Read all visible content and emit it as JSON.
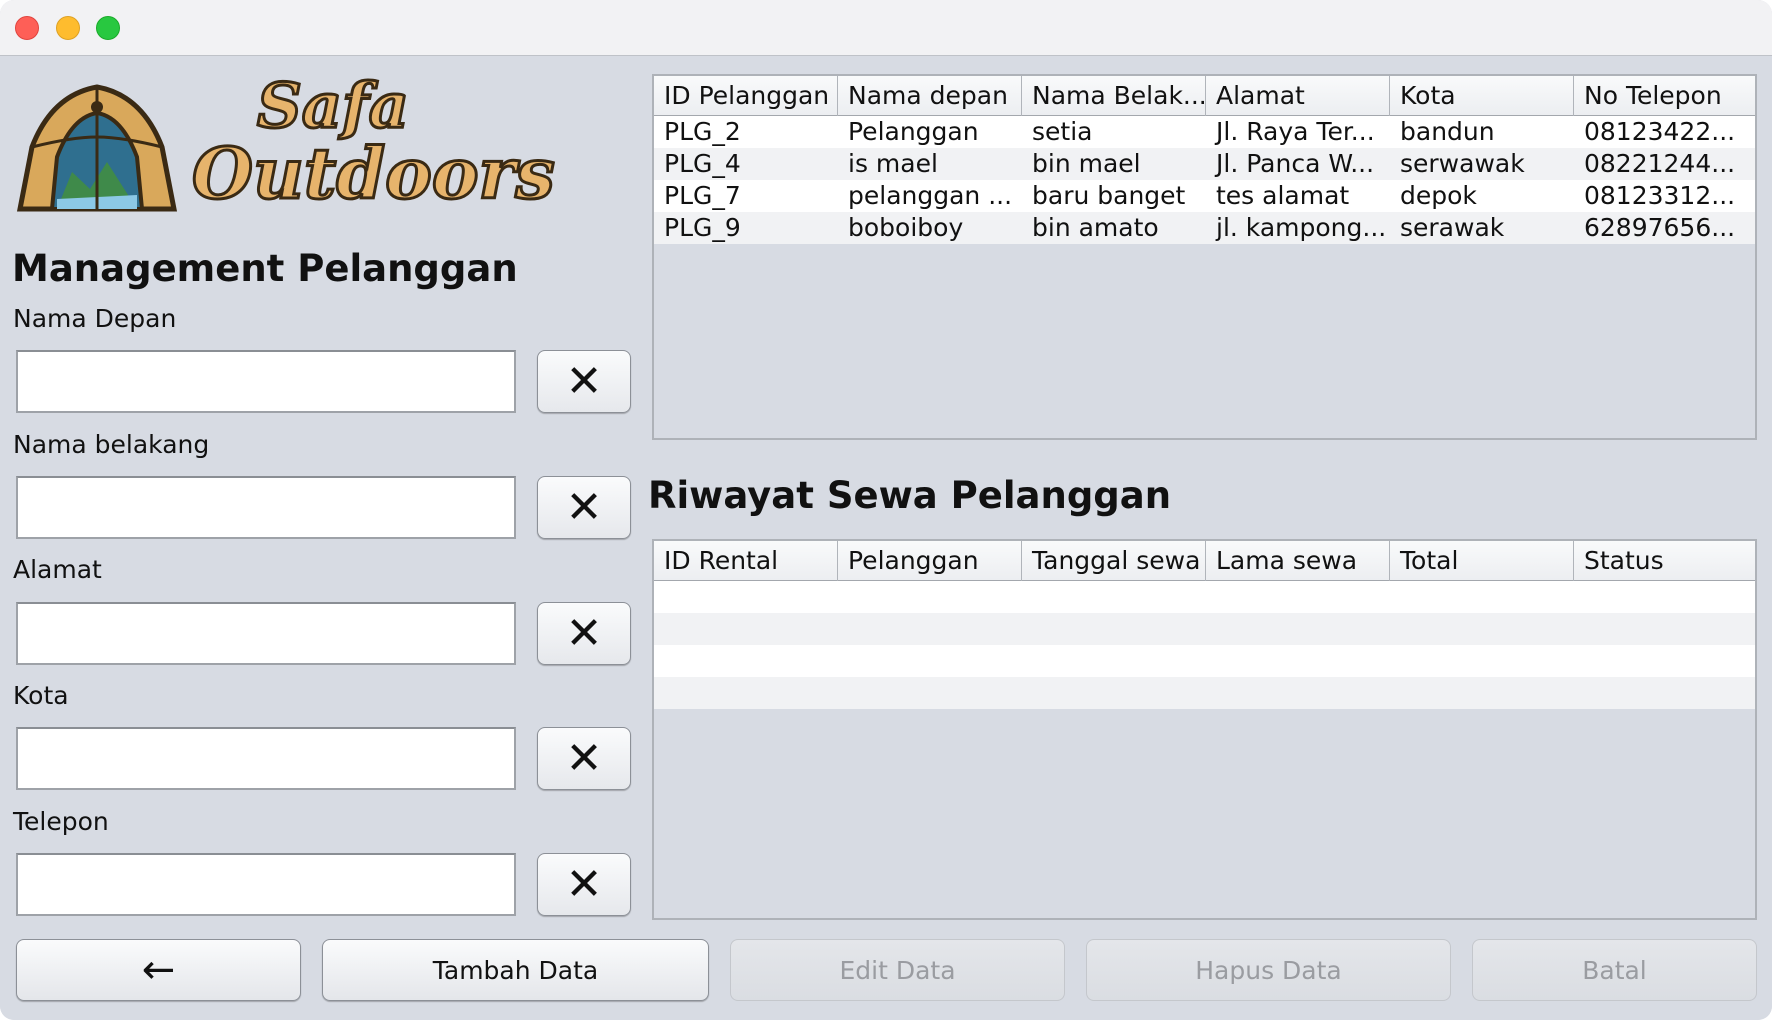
{
  "window": {
    "traffic_lights": [
      "close",
      "minimize",
      "zoom"
    ]
  },
  "logo": {
    "line1": "Safa",
    "line2": "Outdoors",
    "icon": "tent-icon"
  },
  "form": {
    "title": "Management Pelanggan",
    "fields": [
      {
        "label": "Nama Depan",
        "value": "",
        "placeholder": ""
      },
      {
        "label": "Nama belakang",
        "value": "",
        "placeholder": ""
      },
      {
        "label": "Alamat",
        "value": "",
        "placeholder": ""
      },
      {
        "label": "Kota",
        "value": "",
        "placeholder": ""
      },
      {
        "label": "Telepon",
        "value": "",
        "placeholder": ""
      }
    ],
    "clear_glyph": "✕"
  },
  "customers_table": {
    "columns": [
      "ID Pelanggan",
      "Nama depan",
      "Nama Belak...",
      "Alamat",
      "Kota",
      "No Telepon"
    ],
    "rows": [
      [
        "PLG_2",
        "Pelanggan",
        "setia",
        "Jl. Raya Ter...",
        "bandun",
        "08123422..."
      ],
      [
        "PLG_4",
        "is mael",
        "bin mael",
        " Jl. Panca W...",
        "serwawak",
        "08221244..."
      ],
      [
        "PLG_7",
        "pelanggan ...",
        "baru banget",
        "tes alamat",
        "depok",
        "08123312..."
      ],
      [
        "PLG_9",
        "boboiboy",
        "bin amato",
        "jl. kampong...",
        "serawak",
        "62897656..."
      ]
    ]
  },
  "history": {
    "title": "Riwayat Sewa Pelanggan",
    "columns": [
      "ID Rental",
      "Pelanggan",
      "Tanggal sewa",
      "Lama sewa",
      "Total",
      "Status"
    ],
    "rows": []
  },
  "buttons": {
    "back_glyph": "←",
    "add": "Tambah Data",
    "edit": "Edit Data",
    "delete": "Hapus Data",
    "cancel": "Batal"
  }
}
